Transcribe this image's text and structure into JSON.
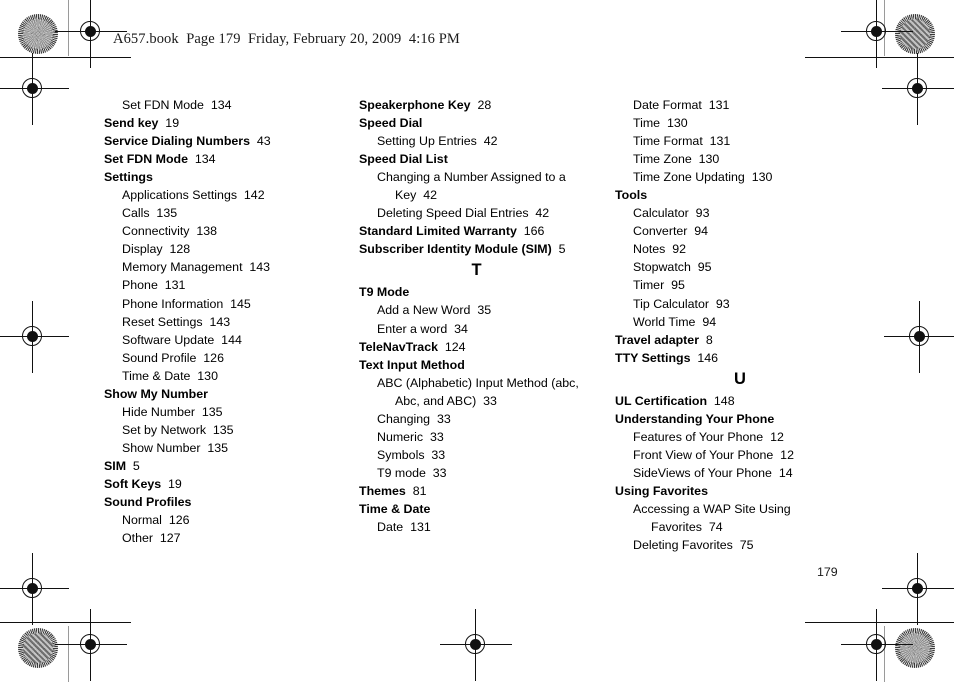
{
  "page": {
    "header_text": "A657.book  Page 179  Friday, February 20, 2009  4:16 PM",
    "folio": "179",
    "document_type": "index"
  },
  "columns": [
    {
      "id": "column-1",
      "entries": [
        {
          "level": 1,
          "text": "Set FDN Mode",
          "page": "134"
        },
        {
          "level": 0,
          "text": "Send key",
          "page": "19"
        },
        {
          "level": 0,
          "text": "Service Dialing Numbers",
          "page": "43"
        },
        {
          "level": 0,
          "text": "Set FDN Mode",
          "page": "134"
        },
        {
          "level": 0,
          "text": "Settings",
          "page": ""
        },
        {
          "level": 1,
          "text": "Applications Settings",
          "page": "142"
        },
        {
          "level": 1,
          "text": "Calls",
          "page": "135"
        },
        {
          "level": 1,
          "text": "Connectivity",
          "page": "138"
        },
        {
          "level": 1,
          "text": "Display",
          "page": "128"
        },
        {
          "level": 1,
          "text": "Memory Management",
          "page": "143"
        },
        {
          "level": 1,
          "text": "Phone",
          "page": "131"
        },
        {
          "level": 1,
          "text": "Phone Information",
          "page": "145"
        },
        {
          "level": 1,
          "text": "Reset Settings",
          "page": "143"
        },
        {
          "level": 1,
          "text": "Software Update",
          "page": "144"
        },
        {
          "level": 1,
          "text": "Sound Profile",
          "page": "126"
        },
        {
          "level": 1,
          "text": "Time & Date",
          "page": "130"
        },
        {
          "level": 0,
          "text": "Show My Number",
          "page": ""
        },
        {
          "level": 1,
          "text": "Hide Number",
          "page": "135"
        },
        {
          "level": 1,
          "text": "Set by Network",
          "page": "135"
        },
        {
          "level": 1,
          "text": "Show Number",
          "page": "135"
        },
        {
          "level": 0,
          "text": "SIM",
          "page": "5"
        },
        {
          "level": 0,
          "text": "Soft Keys",
          "page": "19"
        },
        {
          "level": 0,
          "text": "Sound Profiles",
          "page": ""
        },
        {
          "level": 1,
          "text": "Normal",
          "page": "126"
        },
        {
          "level": 1,
          "text": "Other",
          "page": "127"
        }
      ]
    },
    {
      "id": "column-2",
      "entries": [
        {
          "level": 0,
          "text": "Speakerphone Key",
          "page": "28"
        },
        {
          "level": 0,
          "text": "Speed Dial",
          "page": ""
        },
        {
          "level": 1,
          "text": "Setting Up Entries",
          "page": "42"
        },
        {
          "level": 0,
          "text": "Speed Dial List",
          "page": ""
        },
        {
          "level": 1,
          "text": "Changing a Number Assigned to a Key",
          "page": "42",
          "wrap": true
        },
        {
          "level": 1,
          "text": "Deleting Speed Dial Entries",
          "page": "42"
        },
        {
          "level": 0,
          "text": "Standard Limited Warranty",
          "page": "166",
          "wrap": true
        },
        {
          "level": 0,
          "text": "Subscriber Identity Module (SIM)",
          "page": "5"
        },
        {
          "letter": "T"
        },
        {
          "level": 0,
          "text": "T9 Mode",
          "page": ""
        },
        {
          "level": 1,
          "text": "Add a New Word",
          "page": "35"
        },
        {
          "level": 1,
          "text": "Enter a word",
          "page": "34"
        },
        {
          "level": 0,
          "text": "TeleNavTrack",
          "page": "124"
        },
        {
          "level": 0,
          "text": "Text Input Method",
          "page": ""
        },
        {
          "level": 1,
          "text": "ABC (Alphabetic) Input Method (abc, Abc, and ABC)",
          "page": "33",
          "wrap": true
        },
        {
          "level": 1,
          "text": "Changing",
          "page": "33"
        },
        {
          "level": 1,
          "text": "Numeric",
          "page": "33"
        },
        {
          "level": 1,
          "text": "Symbols",
          "page": "33"
        },
        {
          "level": 1,
          "text": "T9 mode",
          "page": "33"
        },
        {
          "level": 0,
          "text": "Themes",
          "page": "81"
        },
        {
          "level": 0,
          "text": "Time & Date",
          "page": ""
        },
        {
          "level": 1,
          "text": "Date",
          "page": "131"
        }
      ]
    },
    {
      "id": "column-3",
      "entries": [
        {
          "level": 1,
          "text": "Date Format",
          "page": "131"
        },
        {
          "level": 1,
          "text": "Time",
          "page": "130"
        },
        {
          "level": 1,
          "text": "Time Format",
          "page": "131"
        },
        {
          "level": 1,
          "text": "Time Zone",
          "page": "130"
        },
        {
          "level": 1,
          "text": "Time Zone Updating",
          "page": "130"
        },
        {
          "level": 0,
          "text": "Tools",
          "page": ""
        },
        {
          "level": 1,
          "text": "Calculator",
          "page": "93"
        },
        {
          "level": 1,
          "text": "Converter",
          "page": "94"
        },
        {
          "level": 1,
          "text": "Notes",
          "page": "92"
        },
        {
          "level": 1,
          "text": "Stopwatch",
          "page": "95"
        },
        {
          "level": 1,
          "text": "Timer",
          "page": "95"
        },
        {
          "level": 1,
          "text": "Tip Calculator",
          "page": "93"
        },
        {
          "level": 1,
          "text": "World Time",
          "page": "94"
        },
        {
          "level": 0,
          "text": "Travel adapter",
          "page": "8"
        },
        {
          "level": 0,
          "text": "TTY Settings",
          "page": "146"
        },
        {
          "letter": "U"
        },
        {
          "level": 0,
          "text": "UL Certification",
          "page": "148"
        },
        {
          "level": 0,
          "text": "Understanding Your Phone",
          "page": ""
        },
        {
          "level": 1,
          "text": "Features of Your Phone",
          "page": "12"
        },
        {
          "level": 1,
          "text": "Front View of Your Phone",
          "page": "12"
        },
        {
          "level": 1,
          "text": "SideViews of Your Phone",
          "page": "14"
        },
        {
          "level": 0,
          "text": "Using Favorites",
          "page": ""
        },
        {
          "level": 1,
          "text": "Accessing a WAP Site Using Favorites",
          "page": "74",
          "wrap": true
        },
        {
          "level": 1,
          "text": "Deleting Favorites",
          "page": "75"
        }
      ]
    }
  ],
  "print_marks": {
    "registration_mark_name": "registration-target",
    "rosette_name": "color-control-rosette",
    "trim_line_name": "trim-line"
  }
}
